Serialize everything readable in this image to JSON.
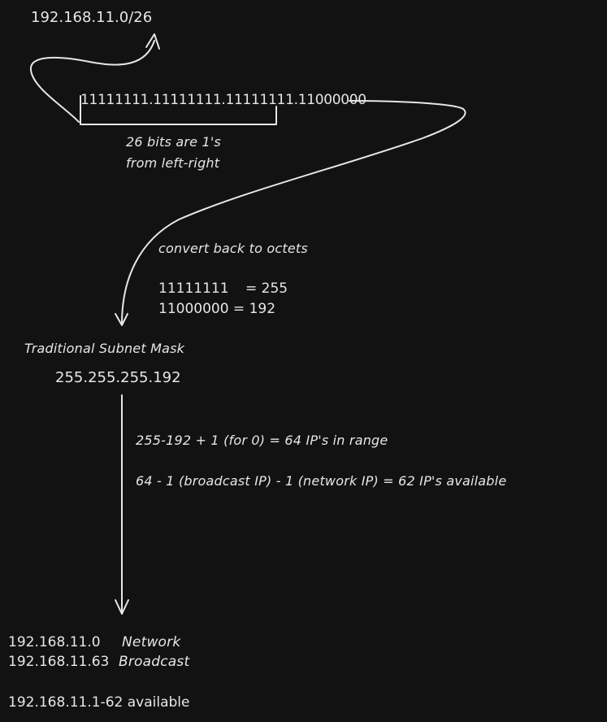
{
  "cidr": "192.168.11.0/26",
  "binary_mask": "11111111.11111111.11111111.11000000",
  "bits_note": {
    "line1": "26 bits are 1's",
    "line2": "from left-right"
  },
  "convert": {
    "title": "convert back to octets",
    "row1_bits": "11111111",
    "row1_value": "= 255",
    "row2": "11000000 = 192"
  },
  "mask": {
    "label": "Traditional Subnet Mask",
    "value": "255.255.255.192"
  },
  "calc": {
    "range": "255-192 + 1 (for 0) = 64 IP's in range",
    "available": "64 - 1 (broadcast IP) - 1 (network IP) = 62 IP's available"
  },
  "results": {
    "network_ip": "192.168.11.0",
    "network_label": "Network",
    "broadcast_ip": "192.168.11.63",
    "broadcast_label": "Broadcast",
    "available": "192.168.11.1-62 available"
  }
}
